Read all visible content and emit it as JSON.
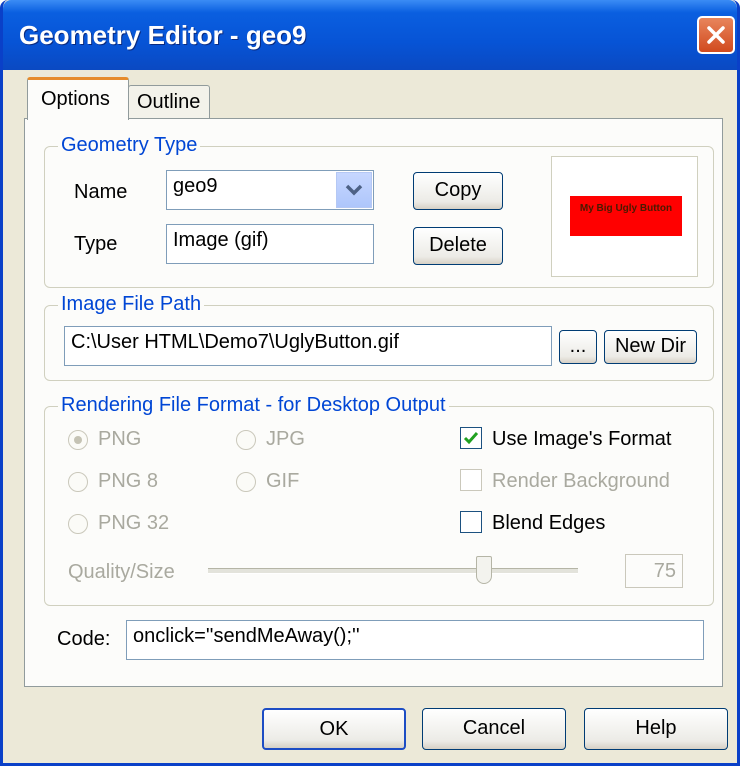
{
  "window": {
    "title": "Geometry Editor - geo9"
  },
  "tabs": [
    {
      "label": "Options",
      "active": true
    },
    {
      "label": "Outline",
      "active": false
    }
  ],
  "geometry_type": {
    "legend": "Geometry Type",
    "name_label": "Name",
    "name_value": "geo9",
    "type_label": "Type",
    "type_value": "Image (gif)",
    "copy_label": "Copy",
    "delete_label": "Delete",
    "preview_text": "My Big Ugly Button"
  },
  "image_path": {
    "legend": "Image File Path",
    "value": "C:\\User HTML\\Demo7\\UglyButton.gif",
    "browse_label": "...",
    "newdir_label": "New Dir"
  },
  "rendering": {
    "legend": "Rendering File Format - for Desktop Output",
    "png": "PNG",
    "png8": "PNG 8",
    "png32": "PNG 32",
    "jpg": "JPG",
    "gif": "GIF",
    "selected_format": "PNG",
    "use_image_format": "Use Image's Format",
    "use_image_format_checked": true,
    "render_background": "Render Background",
    "render_background_checked": false,
    "blend_edges": "Blend Edges",
    "blend_edges_checked": false,
    "quality_label": "Quality/Size",
    "quality_value": "75"
  },
  "code": {
    "label": "Code:",
    "value": "onclick=''sendMeAway();''"
  },
  "buttons": {
    "ok": "OK",
    "cancel": "Cancel",
    "help": "Help"
  },
  "colors": {
    "titlebar": "#0754d6",
    "legend": "#0046d5",
    "face": "#ece9d8",
    "preview_red": "#ff0000"
  }
}
